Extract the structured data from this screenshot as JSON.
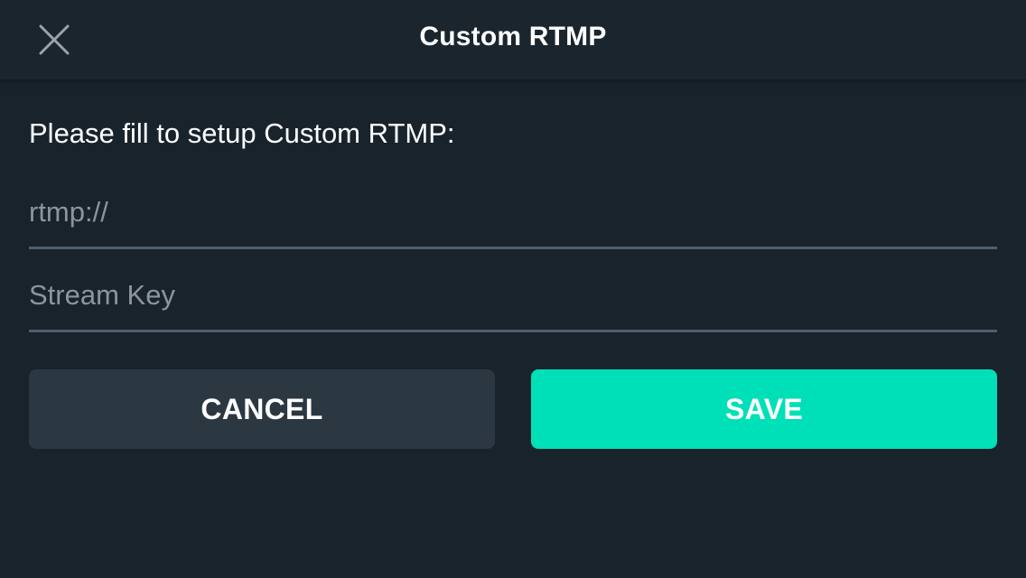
{
  "header": {
    "title": "Custom RTMP",
    "close_icon": "close-icon"
  },
  "form": {
    "instructions": "Please fill to setup Custom RTMP:",
    "url_field": {
      "placeholder": "rtmp://",
      "value": ""
    },
    "stream_key_field": {
      "placeholder": "Stream Key",
      "value": ""
    }
  },
  "actions": {
    "cancel_label": "CANCEL",
    "save_label": "SAVE"
  },
  "colors": {
    "background": "#19232c",
    "header_background": "#1b252e",
    "accent": "#00e0b8",
    "secondary_button": "#2b3842",
    "field_underline": "#4c5f6e",
    "placeholder_text": "#8c959d"
  }
}
